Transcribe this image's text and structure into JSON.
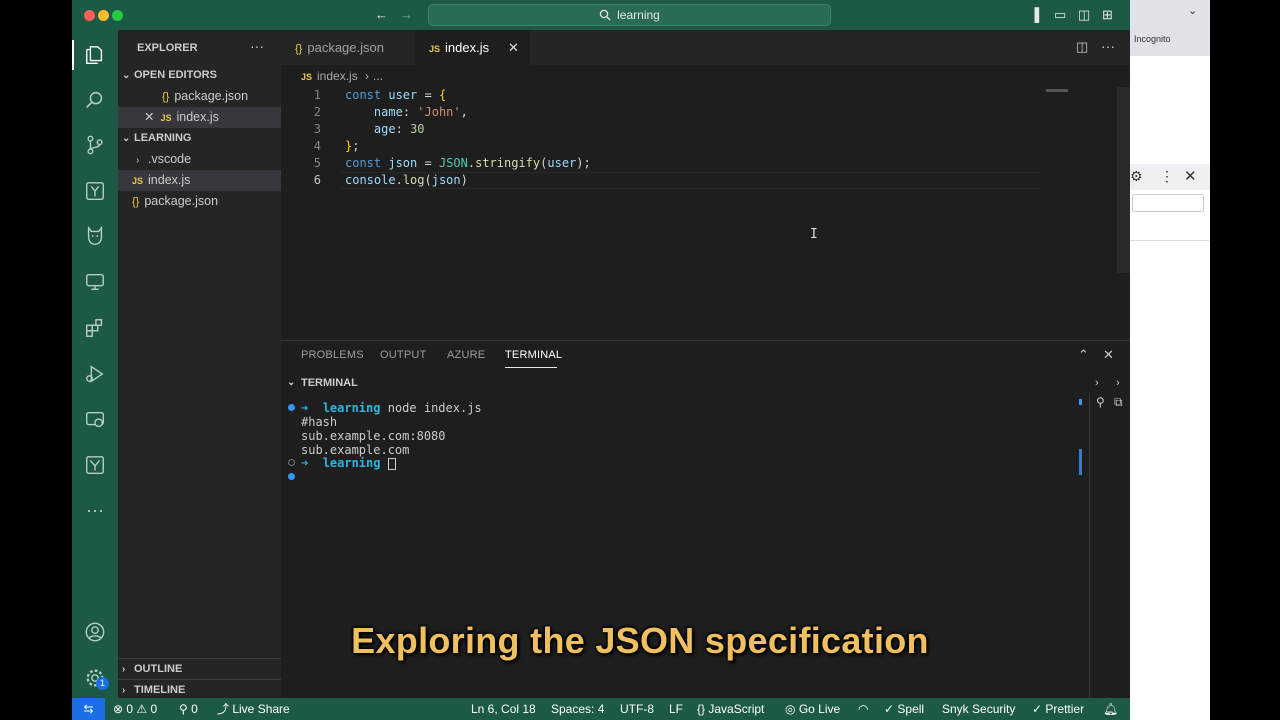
{
  "browser": {
    "incognito_label": "Incognito"
  },
  "window": {
    "search_label": "learning"
  },
  "sidebar": {
    "explorer_title": "EXPLORER",
    "open_editors_title": "OPEN EDITORS",
    "open_editors": [
      {
        "name": "package.json",
        "type": "json"
      },
      {
        "name": "index.js",
        "type": "js"
      }
    ],
    "folder_title": "LEARNING",
    "files": [
      {
        "name": ".vscode",
        "type": "folder"
      },
      {
        "name": "index.js",
        "type": "js"
      },
      {
        "name": "package.json",
        "type": "json"
      }
    ],
    "outline_title": "OUTLINE",
    "timeline_title": "TIMELINE"
  },
  "tabs": [
    {
      "label": "package.json",
      "type": "json"
    },
    {
      "label": "index.js",
      "type": "js",
      "active": true
    }
  ],
  "breadcrumb": {
    "file": "index.js",
    "rest": "..."
  },
  "editor": {
    "line_numbers": [
      "1",
      "2",
      "3",
      "4",
      "5",
      "6"
    ],
    "current_line": 6
  },
  "panel": {
    "tabs": [
      "PROBLEMS",
      "OUTPUT",
      "AZURE",
      "TERMINAL"
    ],
    "active_tab": "TERMINAL",
    "terminal_title": "TERMINAL",
    "prompt_dir": "learning",
    "command": "node index.js",
    "output": [
      "#hash",
      "sub.example.com:8080",
      "sub.example.com"
    ]
  },
  "subtitle": "Exploring the JSON specification",
  "status": {
    "errors": "0",
    "warnings": "0",
    "ports": "0",
    "live_share": "Live Share",
    "position": "Ln 6, Col 18",
    "spaces": "Spaces: 4",
    "encoding": "UTF-8",
    "eol": "LF",
    "language": "JavaScript",
    "go_live": "Go Live",
    "spell": "Spell",
    "snyk": "Snyk Security",
    "prettier": "Prettier"
  },
  "colors": {
    "accent": "#1d5a45",
    "remote": "#1b6ee5",
    "subtitle": "#f0c060"
  }
}
